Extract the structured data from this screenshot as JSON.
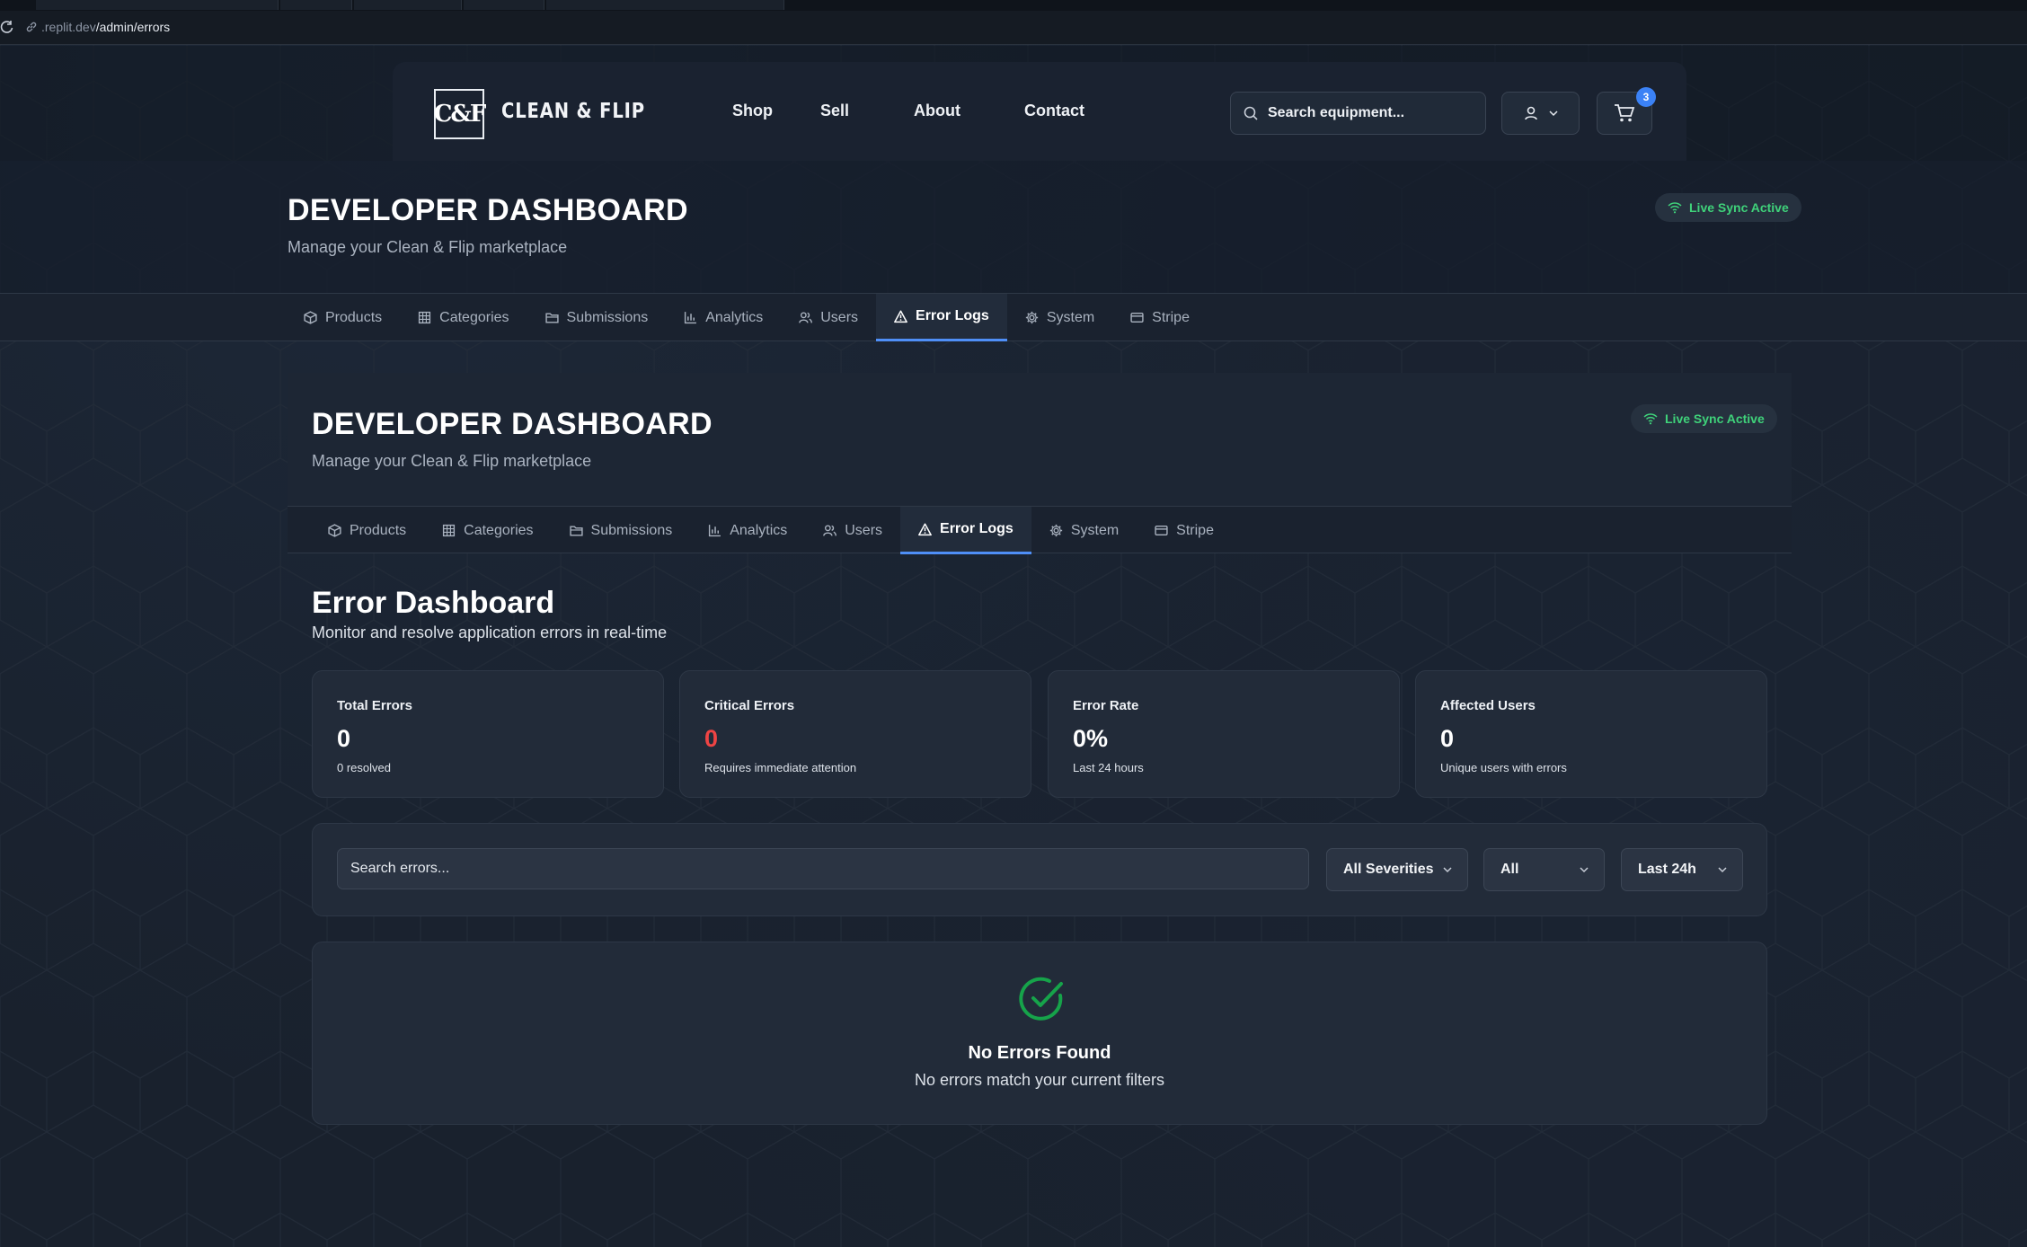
{
  "browser": {
    "url_domain": ".replit.dev",
    "url_path": "/admin/errors"
  },
  "site": {
    "logo_mark": "C&F",
    "logo_text": "CLEAN & FLIP",
    "nav": [
      "Shop",
      "Sell",
      "About",
      "Contact"
    ],
    "search_placeholder": "Search equipment...",
    "cart_count": "3"
  },
  "dashboard": {
    "title": "DEVELOPER DASHBOARD",
    "subtitle": "Manage your Clean & Flip marketplace",
    "sync_label": "Live Sync Active",
    "tabs": [
      {
        "label": "Products",
        "icon": "box-icon"
      },
      {
        "label": "Categories",
        "icon": "grid-icon"
      },
      {
        "label": "Submissions",
        "icon": "folder-icon"
      },
      {
        "label": "Analytics",
        "icon": "bar-chart-icon"
      },
      {
        "label": "Users",
        "icon": "users-icon"
      },
      {
        "label": "Error Logs",
        "icon": "alert-triangle-icon",
        "active": true
      },
      {
        "label": "System",
        "icon": "gear-icon"
      },
      {
        "label": "Stripe",
        "icon": "credit-card-icon"
      }
    ]
  },
  "error_dashboard": {
    "title": "Error Dashboard",
    "subtitle": "Monitor and resolve application errors in real-time",
    "stats": [
      {
        "label": "Total Errors",
        "value": "0",
        "note": "0 resolved"
      },
      {
        "label": "Critical Errors",
        "value": "0",
        "note": "Requires immediate attention",
        "accent": "#ef4444"
      },
      {
        "label": "Error Rate",
        "value": "0%",
        "note": "Last 24 hours"
      },
      {
        "label": "Affected Users",
        "value": "0",
        "note": "Unique users with errors"
      }
    ],
    "filters": {
      "search_placeholder": "Search errors...",
      "severity": "All Severities",
      "status": "All",
      "range": "Last 24h"
    },
    "empty": {
      "title": "No Errors Found",
      "message": "No errors match your current filters"
    }
  },
  "colors": {
    "accent": "#4f8ff7",
    "sync_green": "#3fd27a",
    "critical_red": "#ef4444",
    "success_green": "#16a34a"
  }
}
